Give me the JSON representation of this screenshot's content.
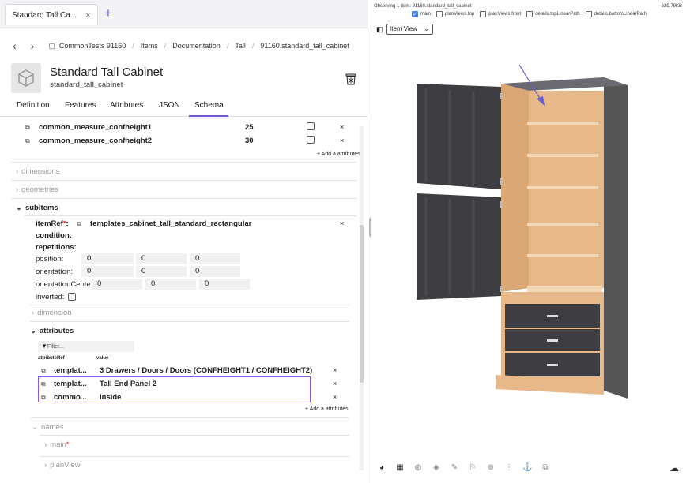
{
  "tab": {
    "title": "Standard Tall Ca...",
    "close": "×",
    "new": "+"
  },
  "breadcrumb": {
    "back": "‹",
    "forward": "›",
    "items": [
      "CommonTests 91160",
      "Items",
      "Documentation",
      "Tall",
      "91160.standard_tall_cabinet"
    ],
    "sep": "/"
  },
  "header": {
    "title": "Standard Tall Cabinet",
    "subtitle": "standard_tall_cabinet"
  },
  "subtabs": [
    "Definition",
    "Features",
    "Attributes",
    "JSON",
    "Schema"
  ],
  "active_subtab": "Schema",
  "measures": [
    {
      "name": "common_measure_confheight1",
      "value": "25"
    },
    {
      "name": "common_measure_confheight2",
      "value": "30"
    }
  ],
  "add_attributes": "+ Add a attributes",
  "sections": {
    "dimensions": "dimensions",
    "geometries": "geometries",
    "subitems": "subItems"
  },
  "subitem": {
    "itemref_label": "itemRef",
    "itemref_required": "*",
    "itemref_value": "templates_cabinet_tall_standard_rectangular",
    "condition": "condition:",
    "repetitions": "repetitions:",
    "position_label": "position:",
    "position": [
      "0",
      "0",
      "0"
    ],
    "orientation_label": "orientation:",
    "orientation": [
      "0",
      "0",
      "0"
    ],
    "orientationcenter_label": "orientationCente",
    "orientationcenter": [
      "0",
      "0",
      "0"
    ],
    "inverted_label": "inverted:",
    "dimension": "dimension",
    "attributes": "attributes",
    "filter": "Filter...",
    "col_attributeref": "attributeRef",
    "col_value": "value",
    "rows": [
      {
        "ref": "templat...",
        "value": "3 Drawers / Doors / Doors (CONFHEIGHT1 / CONFHEIGHT2)"
      },
      {
        "ref": "templat...",
        "value": "Tall End Panel 2"
      },
      {
        "ref": "commo...",
        "value": "Inside"
      }
    ],
    "names": "names",
    "main": "main",
    "main_required": "*",
    "planview": "planView"
  },
  "viewer": {
    "observing": "Observing 1 item: 91160.standard_tall_cabinet",
    "size": "629.79KB",
    "checks": [
      {
        "label": "main",
        "on": true
      },
      {
        "label": "planViews.top",
        "on": false
      },
      {
        "label": "planViews.front",
        "on": false
      },
      {
        "label": "details.topLinearPath",
        "on": false
      },
      {
        "label": "details.bottomLinearPath",
        "on": false
      }
    ],
    "view_mode": "Item View",
    "colors": {
      "cabinet_dark": "#3d3d42",
      "interior_wood": "#e7b98a",
      "accent": "#6b5bd6",
      "highlight": "#8a55e8"
    }
  }
}
